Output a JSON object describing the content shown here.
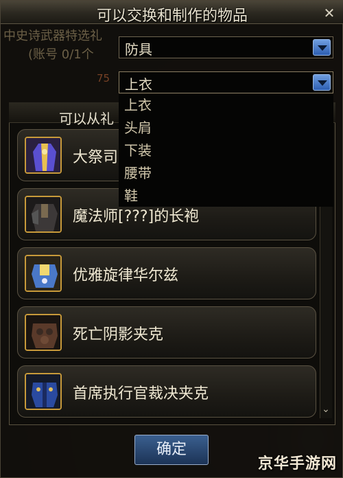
{
  "window": {
    "title": "可以交换和制作的物品"
  },
  "background_panel": {
    "line1": "中史诗武器特选礼",
    "line2": "(账号 0/1个",
    "number": "75"
  },
  "dropdown_category": {
    "value": "防具"
  },
  "dropdown_slot": {
    "value": "上衣",
    "options": [
      "上衣",
      "头肩",
      "下装",
      "腰带",
      "鞋"
    ]
  },
  "list": {
    "header": "可以从礼",
    "items": [
      {
        "name": "大祭司",
        "icon": "robe-icon"
      },
      {
        "name": "魔法师[???]的长袍",
        "icon": "dark-robe-icon"
      },
      {
        "name": "优雅旋律华尔兹",
        "icon": "armor-icon"
      },
      {
        "name": "死亡阴影夹克",
        "icon": "jacket-icon"
      },
      {
        "name": "首席执行官裁决夹克",
        "icon": "blue-jacket-icon"
      }
    ]
  },
  "confirm_label": "确定",
  "watermark": "京华手游网",
  "colors": {
    "accent_blue": "#2d5fb2",
    "icon_border": "#c89a3a",
    "text": "#efe8d2"
  }
}
